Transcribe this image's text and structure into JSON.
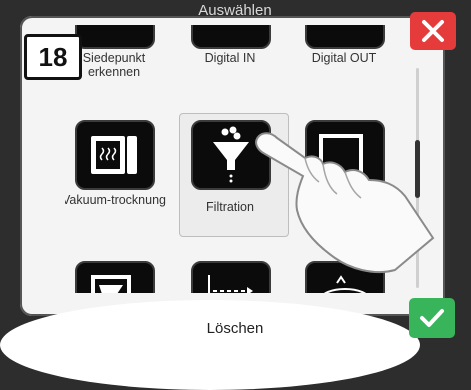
{
  "header": {
    "title": "Auswählen"
  },
  "footer": {
    "label": "Löschen"
  },
  "step": {
    "number": "18"
  },
  "colors": {
    "close": "#e53b3b",
    "confirm": "#38b45a",
    "tile": "#0b0b0b"
  },
  "grid": {
    "row1": [
      "Siedepunkt erkennen",
      "Digital IN",
      "Digital OUT"
    ],
    "row2": [
      {
        "label": "Vakuum-trocknung",
        "icon": "vacuum-drying-icon"
      },
      {
        "label": "Filtration",
        "icon": "filtration-icon",
        "selected": true
      },
      {
        "label": "",
        "icon": "partial-icon"
      }
    ],
    "row3": [
      "level-icon",
      "flow-icon",
      "rotation-icon"
    ]
  },
  "buttons": {
    "close_icon": "close-icon",
    "confirm_icon": "check-icon"
  }
}
